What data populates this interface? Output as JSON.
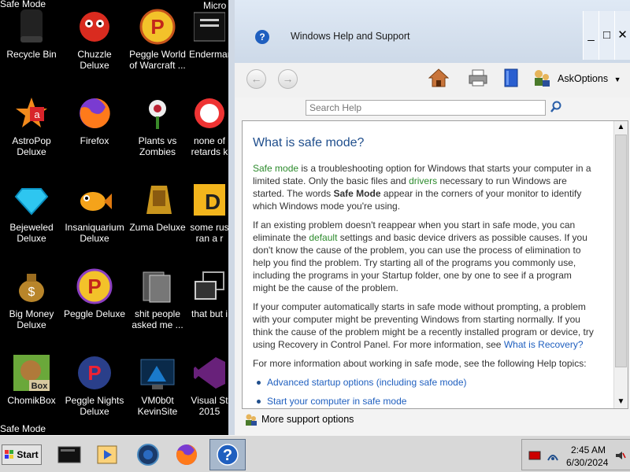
{
  "corner_labels": {
    "top_left": "Safe Mode",
    "bottom_left": "Safe Mode"
  },
  "desktop": {
    "icons": [
      {
        "label": "Recycle Bin"
      },
      {
        "label": "Chuzzle\nDeluxe"
      },
      {
        "label": "Peggle World\nof Warcraft ..."
      },
      {
        "label": "Endermar"
      },
      {
        "label": "AstroPop\nDeluxe"
      },
      {
        "label": "Firefox"
      },
      {
        "label": "Plants vs\nZombies"
      },
      {
        "label": "none of\nretards k"
      },
      {
        "label": "Bejeweled\nDeluxe"
      },
      {
        "label": "Insaniquarium\nDeluxe"
      },
      {
        "label": "Zuma Deluxe"
      },
      {
        "label": "some rus\nran a r"
      },
      {
        "label": "Big Money\nDeluxe"
      },
      {
        "label": "Peggle Deluxe"
      },
      {
        "label": "shit people\nasked me ..."
      },
      {
        "label": "that but i"
      },
      {
        "label": "ChomikBox"
      },
      {
        "label": "Peggle Nights\nDeluxe"
      },
      {
        "label": "VM0b0t\nKevinSite"
      },
      {
        "label": "Visual St\n2015"
      }
    ],
    "partial_top_label": "Micro"
  },
  "help_window": {
    "title": "Windows Help and Support",
    "controls": {
      "minimize": "_",
      "maximize": "□",
      "close": "✕"
    },
    "toolbar": {
      "ask": "Ask",
      "options": "Options"
    },
    "search_placeholder": "Search Help",
    "article": {
      "heading": "What is safe mode?",
      "p1_a": "Safe mode",
      "p1_b": " is a troubleshooting option for Windows that starts your computer in a limited state. Only the basic files and ",
      "p1_c": "drivers",
      "p1_d": " necessary to run Windows are started. The words ",
      "p1_e": "Safe Mode",
      "p1_f": " appear in the corners of your monitor to identify which Windows mode you're using.",
      "p2_a": "If an existing problem doesn't reappear when you start in safe mode, you can eliminate the ",
      "p2_b": "default",
      "p2_c": " settings and basic device drivers as possible causes. If you don't know the cause of the problem, you can use the process of elimination to help you find the problem. Try starting all of the programs you commonly use, including the programs in your Startup folder, one by one to see if a program might be the cause of the problem.",
      "p3_a": "If your computer automatically starts in safe mode without prompting, a problem with your computer might be preventing Windows from starting normally. If you think the cause of the problem might be a recently installed program or device, try using Recovery in Control Panel. For more information, see ",
      "p3_link": "What is Recovery?",
      "p4": "For more information about working in safe mode, see the following Help topics:",
      "links": [
        "Advanced startup options (including safe mode)",
        "Start your computer in safe mode"
      ]
    },
    "more_support": "More support options"
  },
  "taskbar": {
    "start_label": "Start",
    "clock_time": "2:45 AM",
    "clock_date": "6/30/2024"
  }
}
